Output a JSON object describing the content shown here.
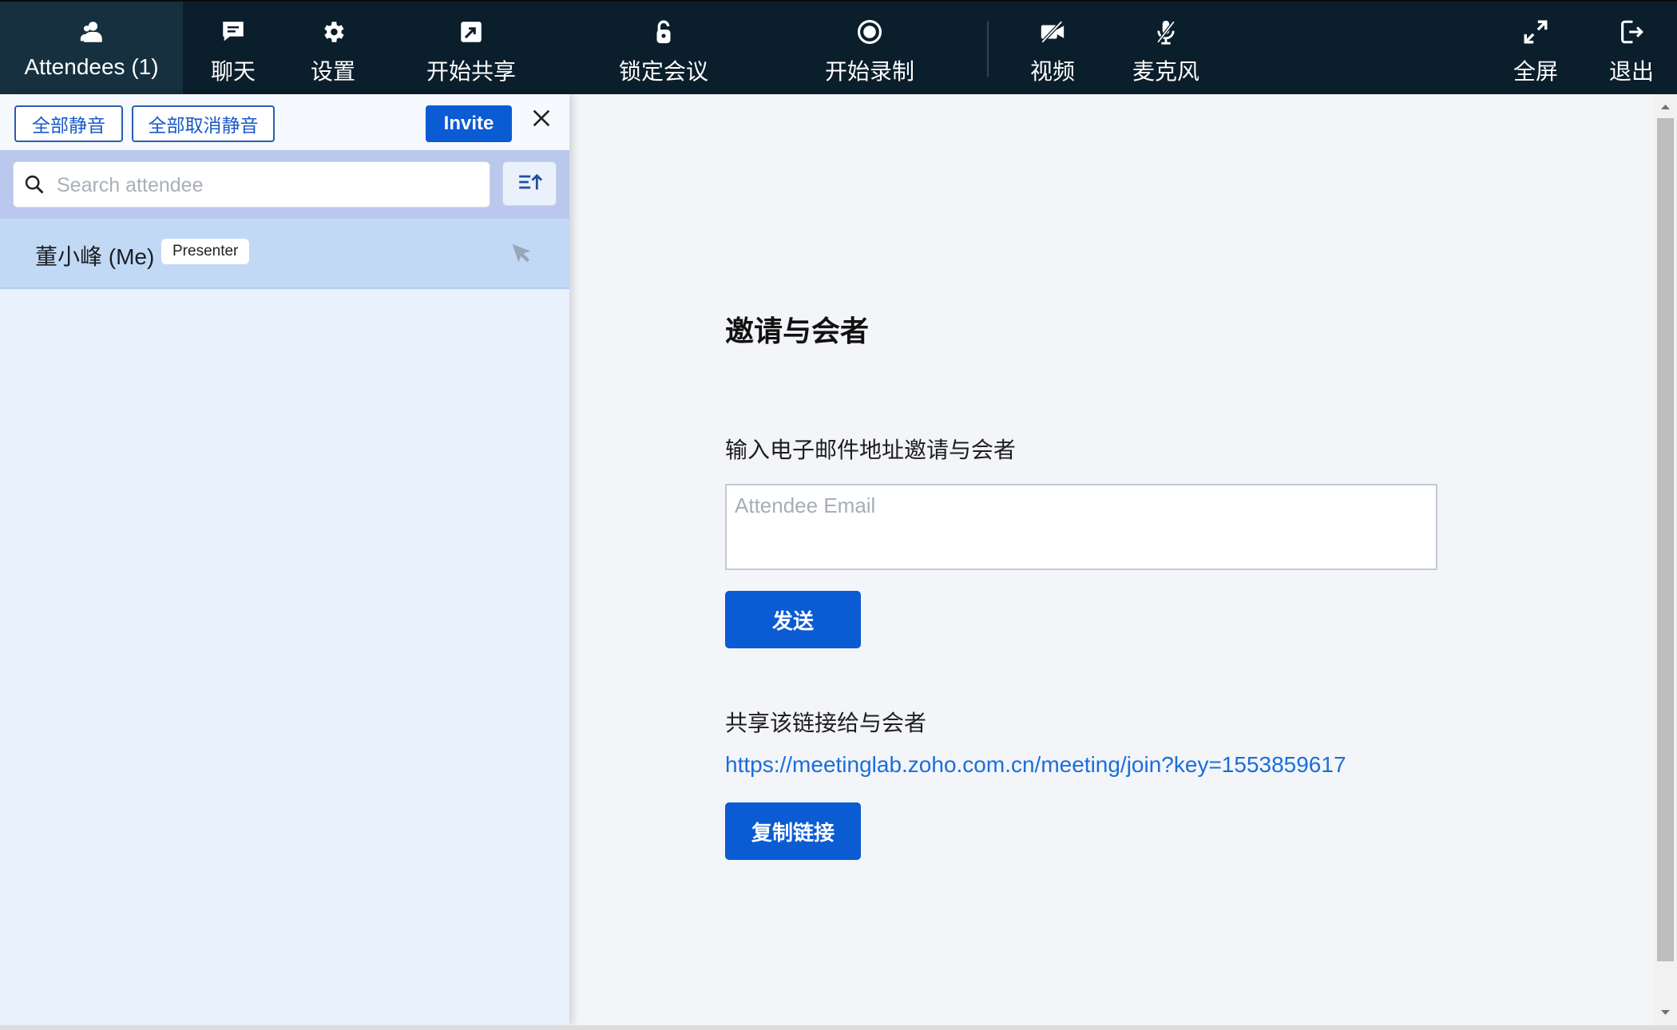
{
  "toolbar": {
    "items": [
      {
        "id": "attendees",
        "label": "Attendees (1)",
        "icon": "attendees-icon",
        "active": true
      },
      {
        "id": "chat",
        "label": "聊天",
        "icon": "chat-icon"
      },
      {
        "id": "settings",
        "label": "设置",
        "icon": "gear-icon"
      },
      {
        "id": "share",
        "label": "开始共享",
        "icon": "share-screen-icon"
      },
      {
        "id": "lock",
        "label": "锁定会议",
        "icon": "lock-icon"
      },
      {
        "id": "record",
        "label": "开始录制",
        "icon": "record-icon"
      },
      {
        "id": "video",
        "label": "视频",
        "icon": "video-off-icon"
      },
      {
        "id": "mic",
        "label": "麦克风",
        "icon": "mic-off-icon"
      },
      {
        "id": "fullscreen",
        "label": "全屏",
        "icon": "fullscreen-icon"
      },
      {
        "id": "exit",
        "label": "退出",
        "icon": "exit-icon"
      }
    ]
  },
  "attendees_panel": {
    "mute_all_label": "全部静音",
    "unmute_all_label": "全部取消静音",
    "invite_label": "Invite",
    "search_placeholder": "Search attendee",
    "attendees": [
      {
        "name": "董小峰 (Me)",
        "role": "Presenter"
      }
    ]
  },
  "invite": {
    "title": "邀请与会者",
    "email_label": "输入电子邮件地址邀请与会者",
    "email_placeholder": "Attendee Email",
    "send_label": "发送",
    "share_label": "共享该链接给与会者",
    "link": "https://meetinglab.zoho.com.cn/meeting/join?key=1553859617",
    "copy_label": "复制链接"
  },
  "colors": {
    "toolbar_bg": "#0b1e2c",
    "accent": "#0b5bd3",
    "link": "#1a6ed8",
    "panel_bg": "#e8f1fc"
  }
}
